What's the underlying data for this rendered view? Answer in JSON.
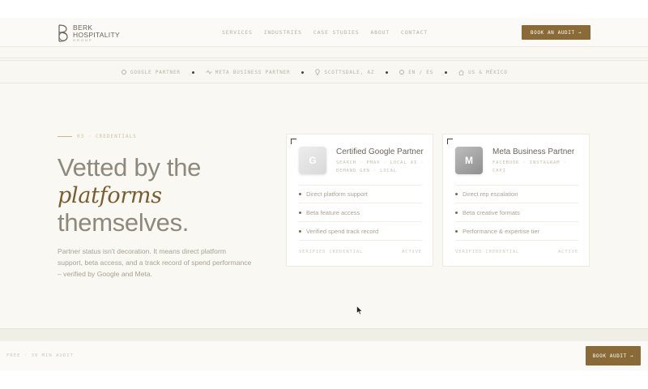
{
  "brand": {
    "line1": "BERK",
    "line2": "HOSPITALITY",
    "line3": "GROUP"
  },
  "nav": [
    {
      "label": "SERVICES"
    },
    {
      "label": "INDUSTRIES"
    },
    {
      "label": "CASE STUDIES"
    },
    {
      "label": "ABOUT"
    },
    {
      "label": "CONTACT"
    }
  ],
  "header_cta": "BOOK AN AUDIT →",
  "badges": [
    {
      "icon": "google-icon",
      "label": "GOOGLE PARTNER"
    },
    {
      "icon": "pulse-icon",
      "label": "META BUSINESS PARTNER"
    },
    {
      "icon": "location-pin-icon",
      "label": "SCOTTSDALE, AZ"
    },
    {
      "icon": "globe-icon",
      "label": "EN / ES"
    },
    {
      "icon": "home-icon",
      "label": "US & MÉXICO"
    }
  ],
  "hero": {
    "eyebrow": "03 · CREDENTIALS",
    "headline_1": "Vetted by the",
    "headline_em": "platforms",
    "headline_2": "themselves.",
    "subtext": "Partner status isn't decoration. It means direct platform support, beta access, and a track record of spend performance – verified by Google and Meta."
  },
  "cards": [
    {
      "avatar": "G",
      "title": "Certified Google Partner",
      "subtitle": "SEARCH · PMAX · LOCAL AI · DEMAND GEN · LOCAL",
      "features": [
        "Direct platform support",
        "Beta feature access",
        "Verified spend track record"
      ],
      "footer_left": "VERIFIED CREDENTIAL",
      "footer_right": "ACTIVE"
    },
    {
      "avatar": "M",
      "title": "Meta Business Partner",
      "subtitle": "FACEBOOK · INSTAGRAM · CAPI",
      "features": [
        "Direct rep escalation",
        "Beta creative formats",
        "Performance & expertise tier"
      ],
      "footer_left": "VERIFIED CREDENTIAL",
      "footer_right": "ACTIVE"
    }
  ],
  "footer": {
    "text": "FREE · 30 MIN AUDIT",
    "cta": "BOOK AUDIT →"
  },
  "colors": {
    "accent": "#8a6a37",
    "background": "#faf8f3"
  }
}
